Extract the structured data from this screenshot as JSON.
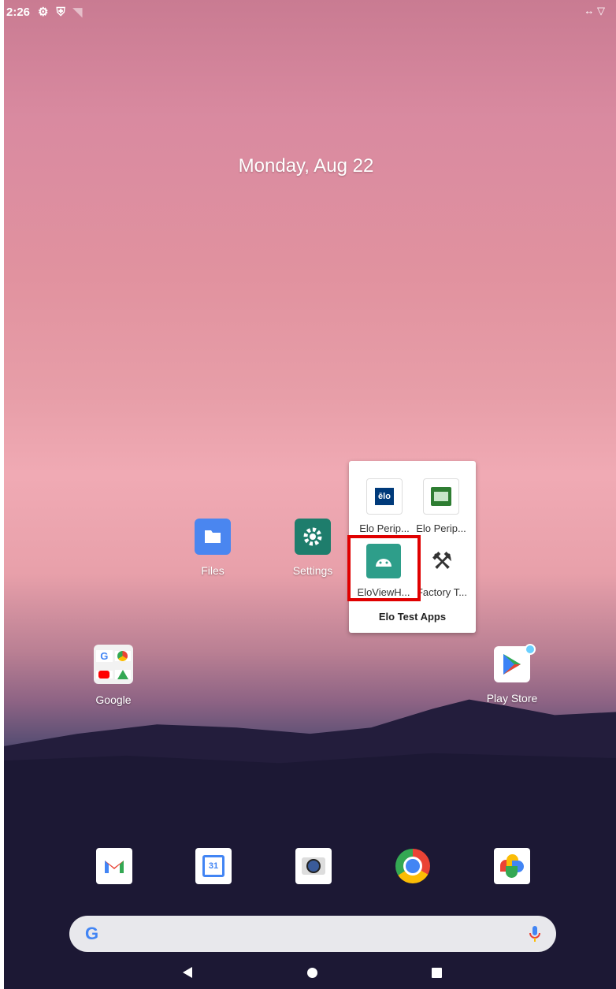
{
  "status_bar": {
    "time": "2:26",
    "right_icons": "↔ ▽"
  },
  "home": {
    "date": "Monday, Aug 22"
  },
  "apps": {
    "files": "Files",
    "settings": "Settings",
    "google": "Google",
    "play_store": "Play Store"
  },
  "folder": {
    "title": "Elo Test Apps",
    "apps": [
      "Elo Perip...",
      "Elo Perip...",
      "EloViewH...",
      "Factory T..."
    ],
    "elo_logo_text": "ēlo"
  },
  "dock": [
    "Gmail",
    "Calendar",
    "Camera",
    "Chrome",
    "Photos"
  ],
  "calendar_day": "31",
  "search": {
    "g_letter": "G"
  },
  "colors": {
    "highlight": "#e00000",
    "folder_bg": "#ffffff"
  }
}
